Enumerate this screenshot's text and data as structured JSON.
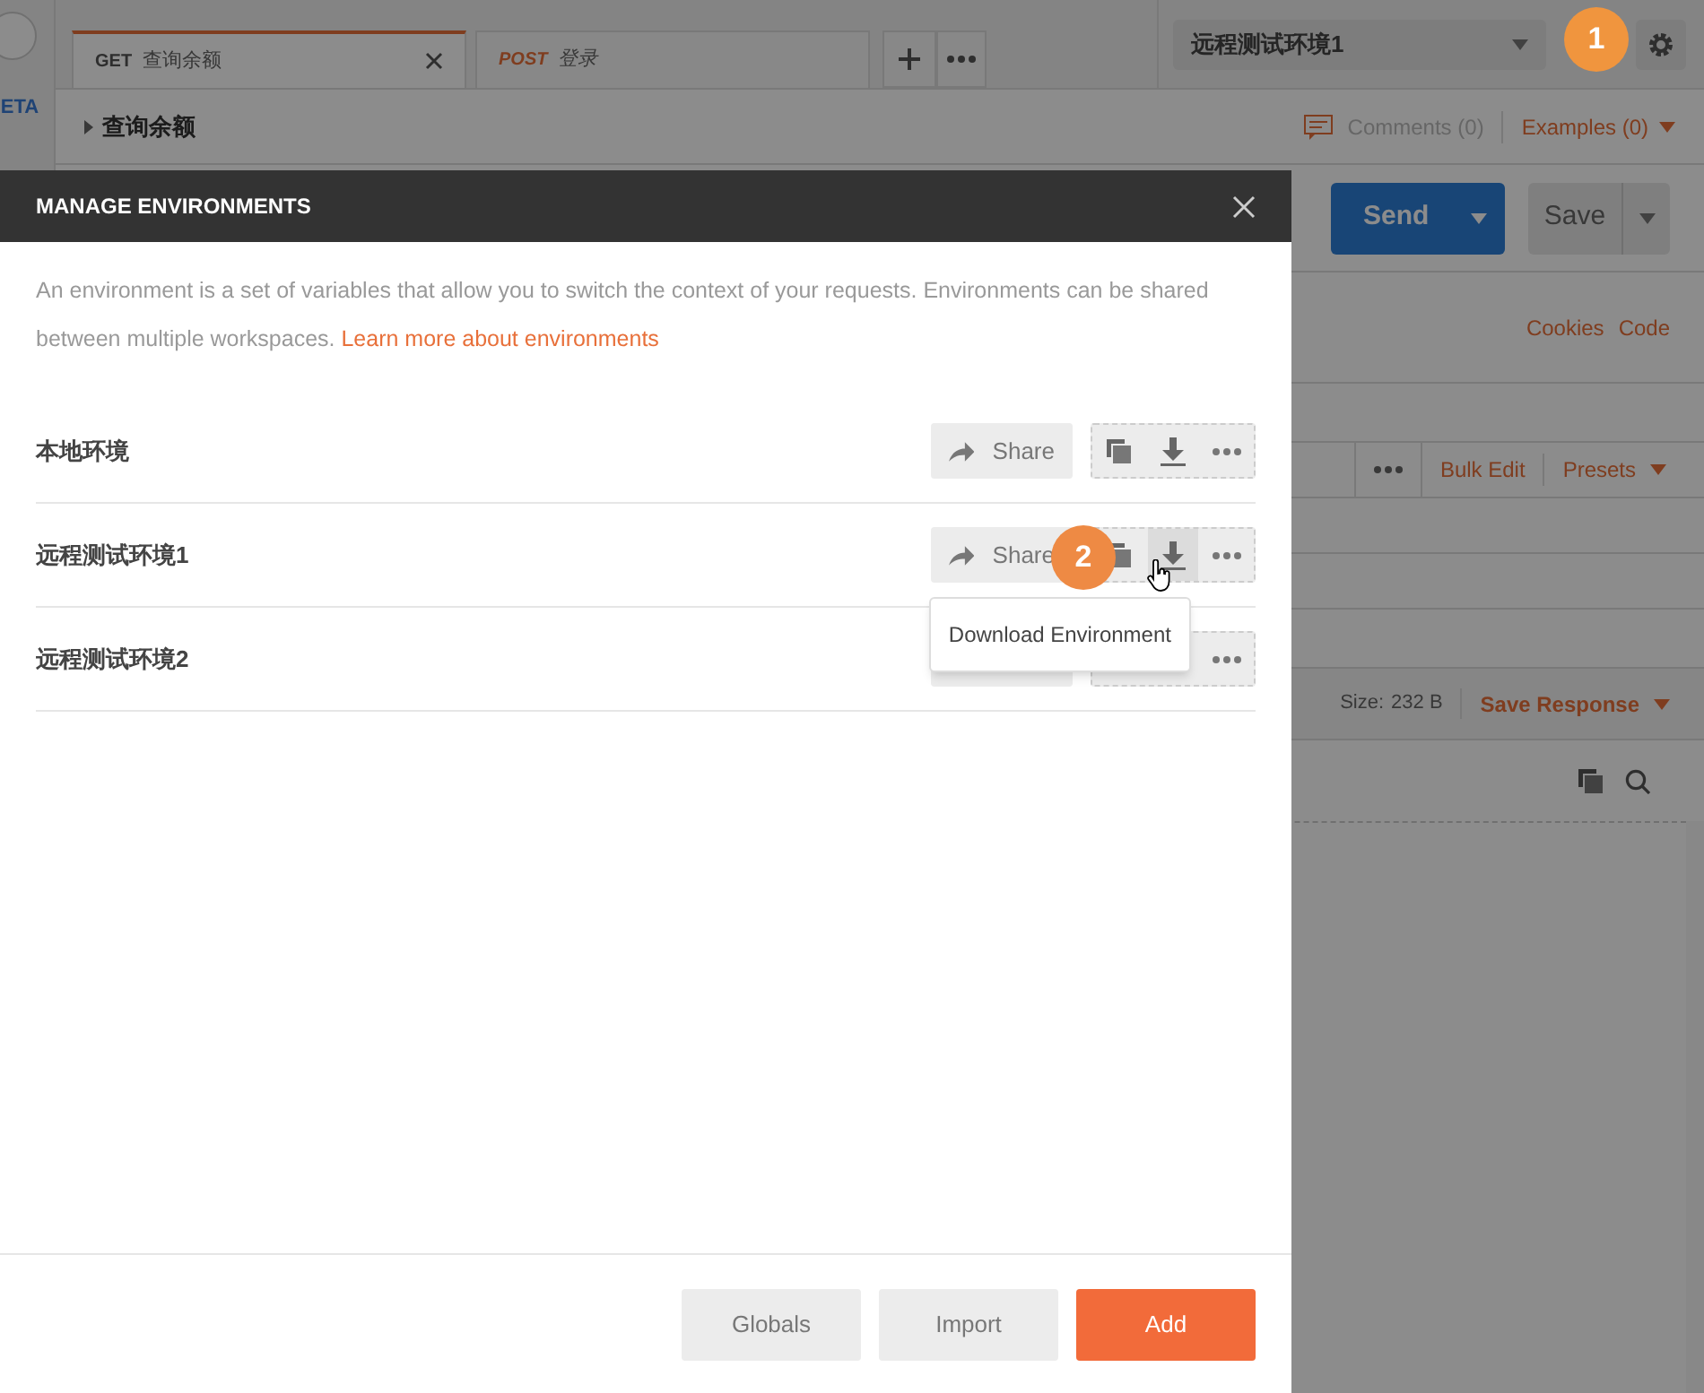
{
  "app": {
    "sidebar_label": "ETA",
    "tabs": [
      {
        "method": "GET",
        "title": "查询余额",
        "selected": true
      },
      {
        "method": "POST",
        "title": "登录",
        "selected": false
      }
    ],
    "environment_select": "远程测试环境1",
    "request_name": "查询余额",
    "comments": "Comments (0)",
    "examples": "Examples (0)",
    "send": "Send",
    "save": "Save",
    "links": [
      "Cookies",
      "Code"
    ],
    "params_actions": [
      "Bulk Edit",
      "Presets"
    ],
    "size_label": "Size:",
    "size_value": "232 B",
    "save_response": "Save Response"
  },
  "step_badges": [
    "1",
    "2"
  ],
  "modal": {
    "title": "MANAGE ENVIRONMENTS",
    "description": "An environment is a set of variables that allow you to switch the context of your requests. Environments can be shared between multiple workspaces.",
    "link": "Learn more about environments",
    "environments": [
      {
        "name": "本地环境",
        "hovered": false,
        "share": "Share",
        "covered_by_tooltip": false
      },
      {
        "name": "远程测试环境1",
        "hovered": true,
        "share": "Share",
        "covered_by_tooltip": false
      },
      {
        "name": "远程测试环境2",
        "hovered": false,
        "covered_by_tooltip": true
      }
    ],
    "tooltip": "Download Environment",
    "buttons": [
      {
        "label": "Globals",
        "kind": "secondary"
      },
      {
        "label": "Import",
        "kind": "secondary"
      },
      {
        "label": "Add",
        "kind": "primary"
      }
    ]
  }
}
